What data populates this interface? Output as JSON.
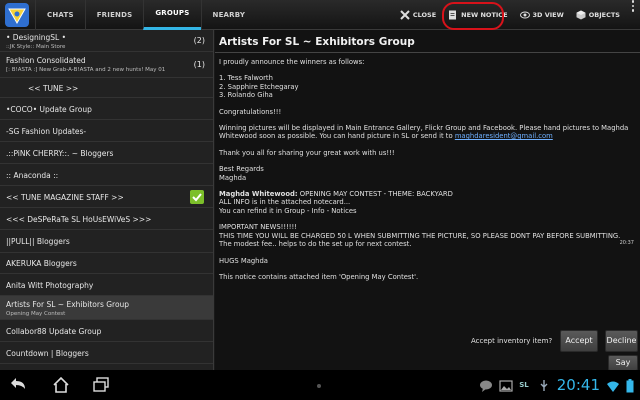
{
  "topbar": {
    "tabs": [
      {
        "label": "CHATS",
        "active": false
      },
      {
        "label": "FRIENDS",
        "active": false
      },
      {
        "label": "GROUPS",
        "active": true
      },
      {
        "label": "NEARBY",
        "active": false
      }
    ],
    "actions": {
      "close": "CLOSE",
      "new_notice": "NEW NOTICE",
      "view_3d": "3D VIEW",
      "objects": "OBJECTS"
    },
    "highlight_color": "#d8121a",
    "accent_color": "#33b5e5"
  },
  "sidebar": {
    "groups": [
      {
        "name": "• DesigningSL •",
        "sub": "::JK Style:: Main Store",
        "count": "(2)"
      },
      {
        "name": "Fashion Consolidated",
        "sub": "[: B!ASTA :] New Grab-A-B!ASTA and 2 new hunts! May 01",
        "count": "(1)"
      },
      {
        "name": "<< TUNE >>"
      },
      {
        "name": "•COCO• Update Group"
      },
      {
        "name": "-SG Fashion Updates-"
      },
      {
        "name": ".::PiNK CHERRY::. ~ Bloggers"
      },
      {
        "name": ":: Anaconda ::"
      },
      {
        "name": "<< TUNE MAGAZINE STAFF >>",
        "checked": true
      },
      {
        "name": "<<< DeSPeRaTe SL HoUsEWiVeS >>>"
      },
      {
        "name": "||PULL|| Bloggers"
      },
      {
        "name": "AKERUKA Bloggers"
      },
      {
        "name": "Anita Witt Photography"
      },
      {
        "name": "Artists For SL ~ Exhibitors Group",
        "sub": "Opening May Contest",
        "selected": true
      },
      {
        "name": "Collabor88 Update Group"
      },
      {
        "name": "Countdown | Bloggers"
      }
    ]
  },
  "notice": {
    "title": "Artists For SL ~ Exhibitors Group",
    "intro": "I proudly announce the winners as follows:",
    "winners": [
      "1. Tess Falworth",
      "2. Sapphire Etchegaray",
      "3. Rolando Giha"
    ],
    "congrats": "Congratulations!!!",
    "winning_text": "Winning pictures will be displayed in Main Entrance Gallery, Flickr Group and Facebook. Please hand pictures to Maghda Whitewood soon as possible. You can hand picture in SL or send it to",
    "email": "maghdaresident@gmail.com",
    "thanks": "Thank you all for sharing your great work with us!!!",
    "regards": "Best Regards",
    "signoff_name": "Maghda",
    "message_author": "Maghda Whitewood:",
    "message_subject": "OPENING MAY CONTEST - THEME: BACKYARD",
    "timestamp": "20:37",
    "info1": "ALL INFO is in the attached notecard...",
    "info2": "You can refind it in Group - Info - Notices",
    "important": "IMPORTANT NEWS!!!!!!",
    "charge": "THIS TIME YOU WILL BE CHARGED 50 L WHEN SUBMITTING THE PICTURE, SO PLEASE DONT PAY BEFORE SUBMITTING.",
    "fee": "The modest fee.. helps to do the set up for next contest.",
    "hugs": "HUGS Maghda",
    "attachment": "This notice contains attached item 'Opening May Contest'.",
    "inventory_question": "Accept inventory item?",
    "accept_label": "Accept",
    "decline_label": "Decline",
    "say_label": "Say"
  },
  "statusbar": {
    "sl_label": "SL",
    "clock": "20:41",
    "clock_color": "#34b7ea"
  }
}
